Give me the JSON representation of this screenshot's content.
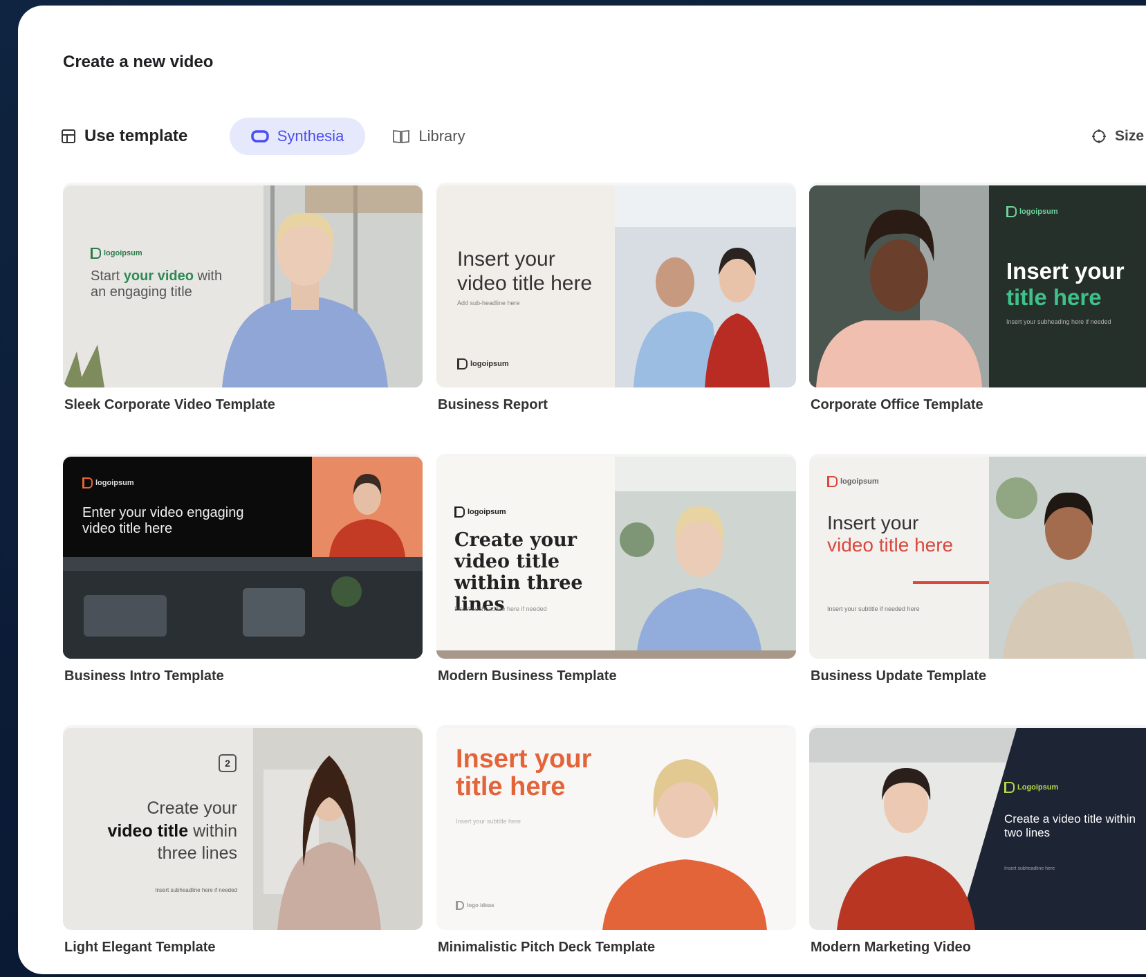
{
  "dialog": {
    "title": "Create a new video"
  },
  "tabs": {
    "use_template": "Use template",
    "synthesia": "Synthesia",
    "library": "Library",
    "size": "Size"
  },
  "templates": [
    {
      "name": "Sleek Corporate Video Template",
      "logo": "logoipsum",
      "heading_a": "Start ",
      "heading_b": "your video",
      "heading_c": " with",
      "heading_d": "an engaging title"
    },
    {
      "name": "Business Report",
      "logo": "logoipsum",
      "heading": "Insert your video title here",
      "subheading": "Add sub-headline here"
    },
    {
      "name": "Corporate Office Template",
      "logo": "logoipsum",
      "heading_a": "Insert your",
      "heading_b": "title here",
      "subheading": "Insert your subheading here if needed"
    },
    {
      "name": "Business Intro Template",
      "logo": "logoipsum",
      "heading": "Enter your video engaging video title here"
    },
    {
      "name": "Modern Business Template",
      "logo": "logoipsum",
      "heading": "Create your video title within three lines",
      "subheading": "Insert subheadline here if needed"
    },
    {
      "name": "Business Update Template",
      "logo": "logoipsum",
      "heading_a": "Insert your",
      "heading_b": "video title here",
      "subheading": "Insert your subtitle if needed here"
    },
    {
      "name": "Light Elegant Template",
      "badge": "2",
      "heading_a": "Create your",
      "heading_b": "video title",
      "heading_c": " within",
      "heading_d": "three lines",
      "subheading": "Insert subheadline here if needed"
    },
    {
      "name": "Minimalistic Pitch Deck Template",
      "heading": "Insert your title here",
      "subheading": "Insert your subtitle here",
      "logo": "logo ideas"
    },
    {
      "name": "Modern Marketing Video",
      "logo": "Logoipsum",
      "heading": "Create a video title within two lines",
      "subheading": "Insert subheadline here"
    }
  ],
  "colors": {
    "accent": "#4a4ff0",
    "synthesia_tab_bg": "#e6e9fb",
    "green_accent": "#3fc28a",
    "orange_accent": "#e4643a",
    "red_accent": "#d9473d"
  },
  "icons": {
    "use_template": "template-grid-icon",
    "synthesia": "synthesia-logo-icon",
    "library": "book-icon",
    "size": "aspect-ratio-icon"
  }
}
